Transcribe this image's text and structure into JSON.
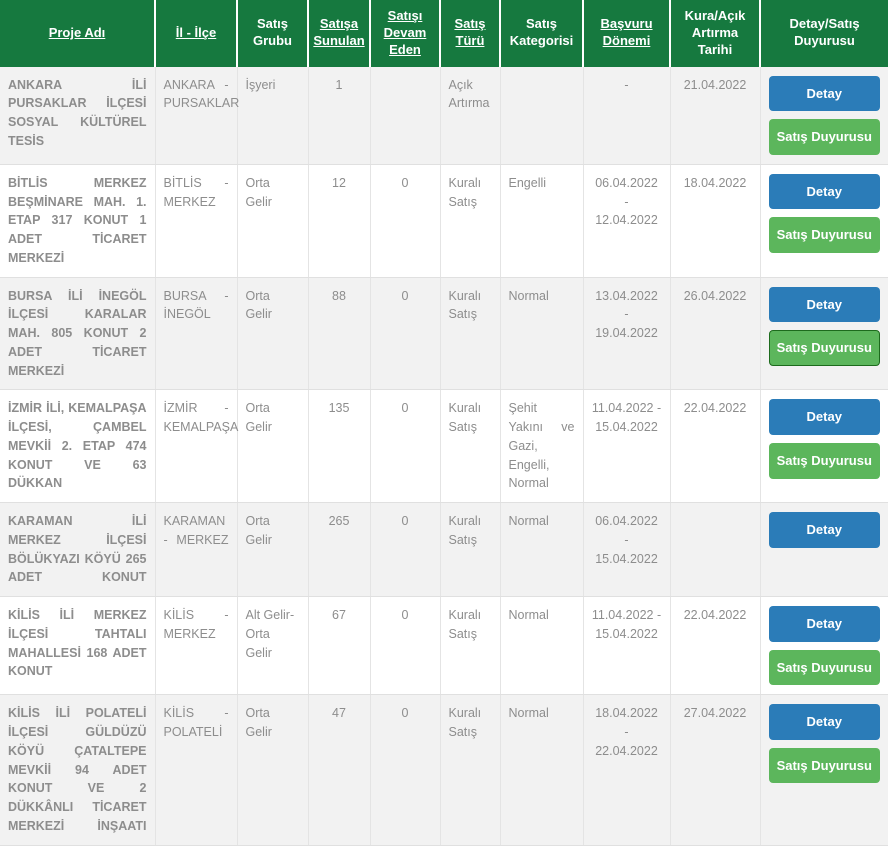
{
  "table": {
    "columns": [
      {
        "id": "proje-adi",
        "label": "Proje Adı",
        "sortable": true,
        "align": "center"
      },
      {
        "id": "il-ilce",
        "label": "İl - İlçe",
        "sortable": true,
        "align": "center"
      },
      {
        "id": "satis-grubu",
        "label": "Satış Grubu",
        "sortable": false,
        "align": "center"
      },
      {
        "id": "satisa-sunulan",
        "label": "Satışa Sunulan",
        "sortable": true,
        "align": "center"
      },
      {
        "id": "satisi-devam-eden",
        "label": "Satışı Devam Eden",
        "sortable": true,
        "align": "center"
      },
      {
        "id": "satis-turu",
        "label": "Satış Türü",
        "sortable": true,
        "align": "center"
      },
      {
        "id": "satis-kategorisi",
        "label": "Satış Kategorisi",
        "sortable": false,
        "align": "center"
      },
      {
        "id": "basvuru-donemi",
        "label": "Başvuru Dönemi",
        "sortable": true,
        "align": "center"
      },
      {
        "id": "kura-acik-artirma-tarihi",
        "label": "Kura/Açık Artırma Tarihi",
        "sortable": false,
        "align": "center"
      },
      {
        "id": "detay-satis-duyurusu",
        "label": "Detay/Satış Duyurusu",
        "sortable": false,
        "align": "center"
      }
    ],
    "header_lines": {
      "proje-adi": [
        "Proje Adı"
      ],
      "il-ilce": [
        "İl - İlçe"
      ],
      "satis-grubu": [
        "Satış",
        "Grubu"
      ],
      "satisa-sunulan": [
        "Satışa",
        "Sunulan"
      ],
      "satisi-devam-eden": [
        "Satışı",
        "Devam",
        "Eden"
      ],
      "satis-turu": [
        "Satış",
        "Türü"
      ],
      "satis-kategorisi": [
        "Satış",
        "Kategorisi"
      ],
      "basvuru-donemi": [
        "Başvuru",
        "Dönemi"
      ],
      "kura-acik-artirma-tarihi": [
        "Kura/Açık",
        "Artırma",
        "Tarihi"
      ],
      "detay-satis-duyurusu": [
        "Detay/Satış",
        "Duyurusu"
      ]
    },
    "rows": [
      {
        "proje_adi": "ANKARA İLİ PURSAKLAR İLÇESİ SOSYAL KÜLTÜREL TESİS",
        "il_ilce": "ANKARA - PURSAKLAR",
        "satis_grubu": "İşyeri",
        "satisa_sunulan": "1",
        "satisi_devam_eden": "",
        "satis_turu": "Açık Artırma",
        "satis_kategorisi": "",
        "basvuru_donemi": "-",
        "kura_tarihi": "21.04.2022",
        "detay_label": "Detay",
        "duyuru_label": "Satış Duyurusu",
        "has_detay": true,
        "has_duyuru": true,
        "duyuru_focused": false
      },
      {
        "proje_adi": "BİTLİS MERKEZ BEŞMİNARE MAH. 1. ETAP 317 KONUT 1 ADET TİCARET MERKEZİ",
        "il_ilce": "BİTLİS - MERKEZ",
        "satis_grubu": "Orta Gelir",
        "satisa_sunulan": "12",
        "satisi_devam_eden": "0",
        "satis_turu": "Kuralı Satış",
        "satis_kategorisi": "Engelli",
        "basvuru_donemi": "06.04.2022 - 12.04.2022",
        "kura_tarihi": "18.04.2022",
        "detay_label": "Detay",
        "duyuru_label": "Satış Duyurusu",
        "has_detay": true,
        "has_duyuru": true,
        "duyuru_focused": false
      },
      {
        "proje_adi": "BURSA İLİ İNEGÖL İLÇESİ KARALAR MAH. 805 KONUT 2 ADET TİCARET MERKEZİ",
        "il_ilce": "BURSA - İNEGÖL",
        "satis_grubu": "Orta Gelir",
        "satisa_sunulan": "88",
        "satisi_devam_eden": "0",
        "satis_turu": "Kuralı Satış",
        "satis_kategorisi": "Normal",
        "basvuru_donemi": "13.04.2022 - 19.04.2022",
        "kura_tarihi": "26.04.2022",
        "detay_label": "Detay",
        "duyuru_label": "Satış Duyurusu",
        "has_detay": true,
        "has_duyuru": true,
        "duyuru_focused": true
      },
      {
        "proje_adi": "İZMİR İLİ, KEMALPAŞA İLÇESİ, ÇAMBEL MEVKİİ 2. ETAP 474 KONUT VE 63 DÜKKAN",
        "il_ilce": "İZMİR - KEMALPAŞA",
        "satis_grubu": "Orta Gelir",
        "satisa_sunulan": "135",
        "satisi_devam_eden": "0",
        "satis_turu": "Kuralı Satış",
        "satis_kategorisi": "Şehit Yakını ve Gazi, Engelli, Normal",
        "basvuru_donemi": "11.04.2022 - 15.04.2022",
        "kura_tarihi": "22.04.2022",
        "detay_label": "Detay",
        "duyuru_label": "Satış Duyurusu",
        "has_detay": true,
        "has_duyuru": true,
        "duyuru_focused": false
      },
      {
        "proje_adi": "KARAMAN İLİ MERKEZ İLÇESİ BÖLÜKYAZI KÖYÜ 265 ADET KONUT",
        "il_ilce": "KARAMAN - MERKEZ",
        "satis_grubu": "Orta Gelir",
        "satisa_sunulan": "265",
        "satisi_devam_eden": "0",
        "satis_turu": "Kuralı Satış",
        "satis_kategorisi": "Normal",
        "basvuru_donemi": "06.04.2022 - 15.04.2022",
        "kura_tarihi": "",
        "detay_label": "Detay",
        "duyuru_label": "Satış Duyurusu",
        "has_detay": true,
        "has_duyuru": false,
        "duyuru_focused": false
      },
      {
        "proje_adi": "KİLİS İLİ MERKEZ İLÇESİ TAHTALI MAHALLESİ 168 ADET KONUT",
        "il_ilce": "KİLİS - MERKEZ",
        "satis_grubu": "Alt Gelir- Orta Gelir",
        "satisa_sunulan": "67",
        "satisi_devam_eden": "0",
        "satis_turu": "Kuralı Satış",
        "satis_kategorisi": "Normal",
        "basvuru_donemi": "11.04.2022 - 15.04.2022",
        "kura_tarihi": "22.04.2022",
        "detay_label": "Detay",
        "duyuru_label": "Satış Duyurusu",
        "has_detay": true,
        "has_duyuru": true,
        "duyuru_focused": false
      },
      {
        "proje_adi": "KİLİS İLİ POLATELİ İLÇESİ GÜLDÜZÜ KÖYÜ ÇATALTEPE MEVKİİ 94 ADET KONUT VE 2 DÜKKÂNLI TİCARET MERKEZİ İNŞAATI",
        "il_ilce": "KİLİS - POLATELİ",
        "satis_grubu": "Orta Gelir",
        "satisa_sunulan": "47",
        "satisi_devam_eden": "0",
        "satis_turu": "Kuralı Satış",
        "satis_kategorisi": "Normal",
        "basvuru_donemi": "18.04.2022 - 22.04.2022",
        "kura_tarihi": "27.04.2022",
        "detay_label": "Detay",
        "duyuru_label": "Satış Duyurusu",
        "has_detay": true,
        "has_duyuru": true,
        "duyuru_focused": false
      }
    ]
  },
  "colors": {
    "header_bg": "#16793f",
    "detay_button": "#2b7cb8",
    "duyuru_button": "#5cb65c",
    "duyuru_button_focus_border": "#1d6b1d",
    "project_text": "#2d6a53",
    "row_alt_bg": "#f2f2f2"
  }
}
